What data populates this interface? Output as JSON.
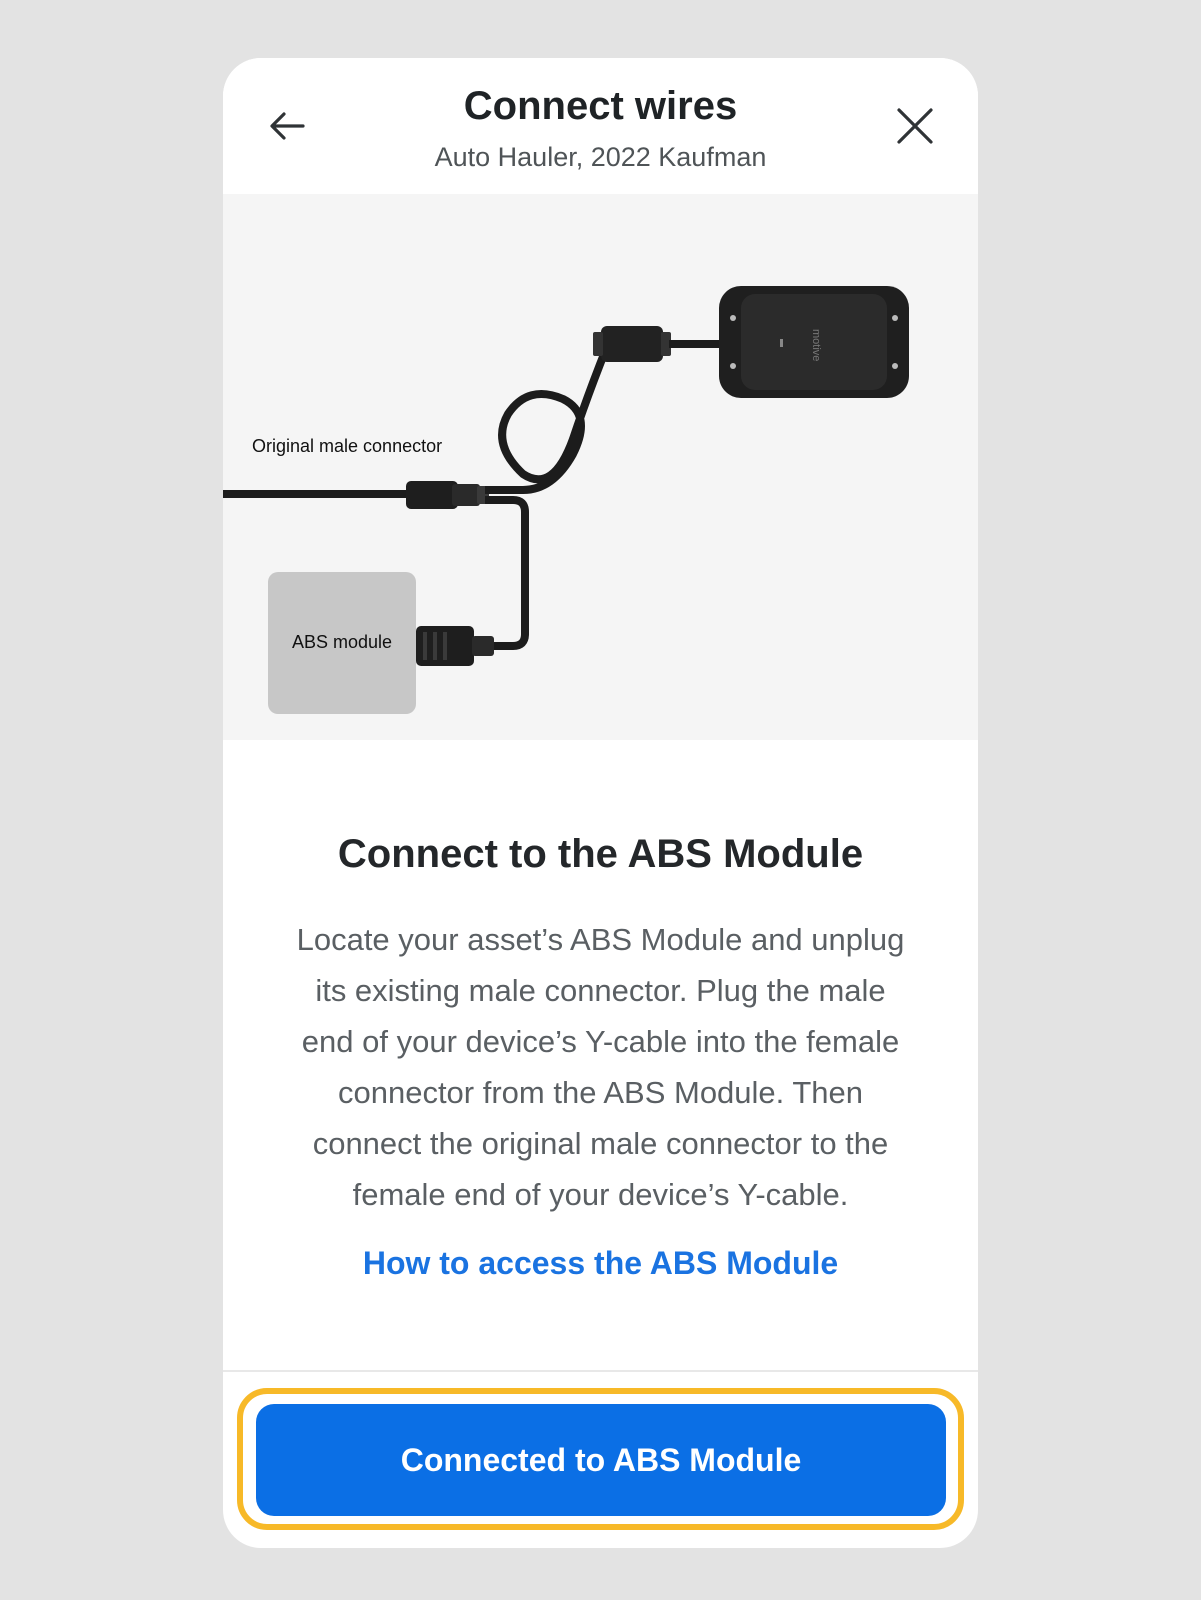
{
  "header": {
    "title": "Connect wires",
    "subtitle": "Auto Hauler, 2022 Kaufman",
    "back_icon": "arrow-left-icon",
    "close_icon": "close-icon"
  },
  "illustration": {
    "label_connector": "Original male connector",
    "label_module": "ABS module",
    "device_brand": "motive"
  },
  "content": {
    "title": "Connect to the ABS Module",
    "body_lines": [
      "Locate your asset’s ABS Module and unplug",
      "its existing male connector. Plug the male",
      "end of your device’s Y-cable into the female",
      "connector from the ABS Module. Then",
      "connect the original male connector to the",
      "female end of your device’s Y-cable."
    ],
    "link": "How to access the ABS Module"
  },
  "footer": {
    "button_label": "Connected to ABS Module"
  },
  "colors": {
    "primary": "#0b6fe5",
    "link": "#1a73e1",
    "focus_ring": "#f7b928",
    "background": "#e3e3e3"
  }
}
